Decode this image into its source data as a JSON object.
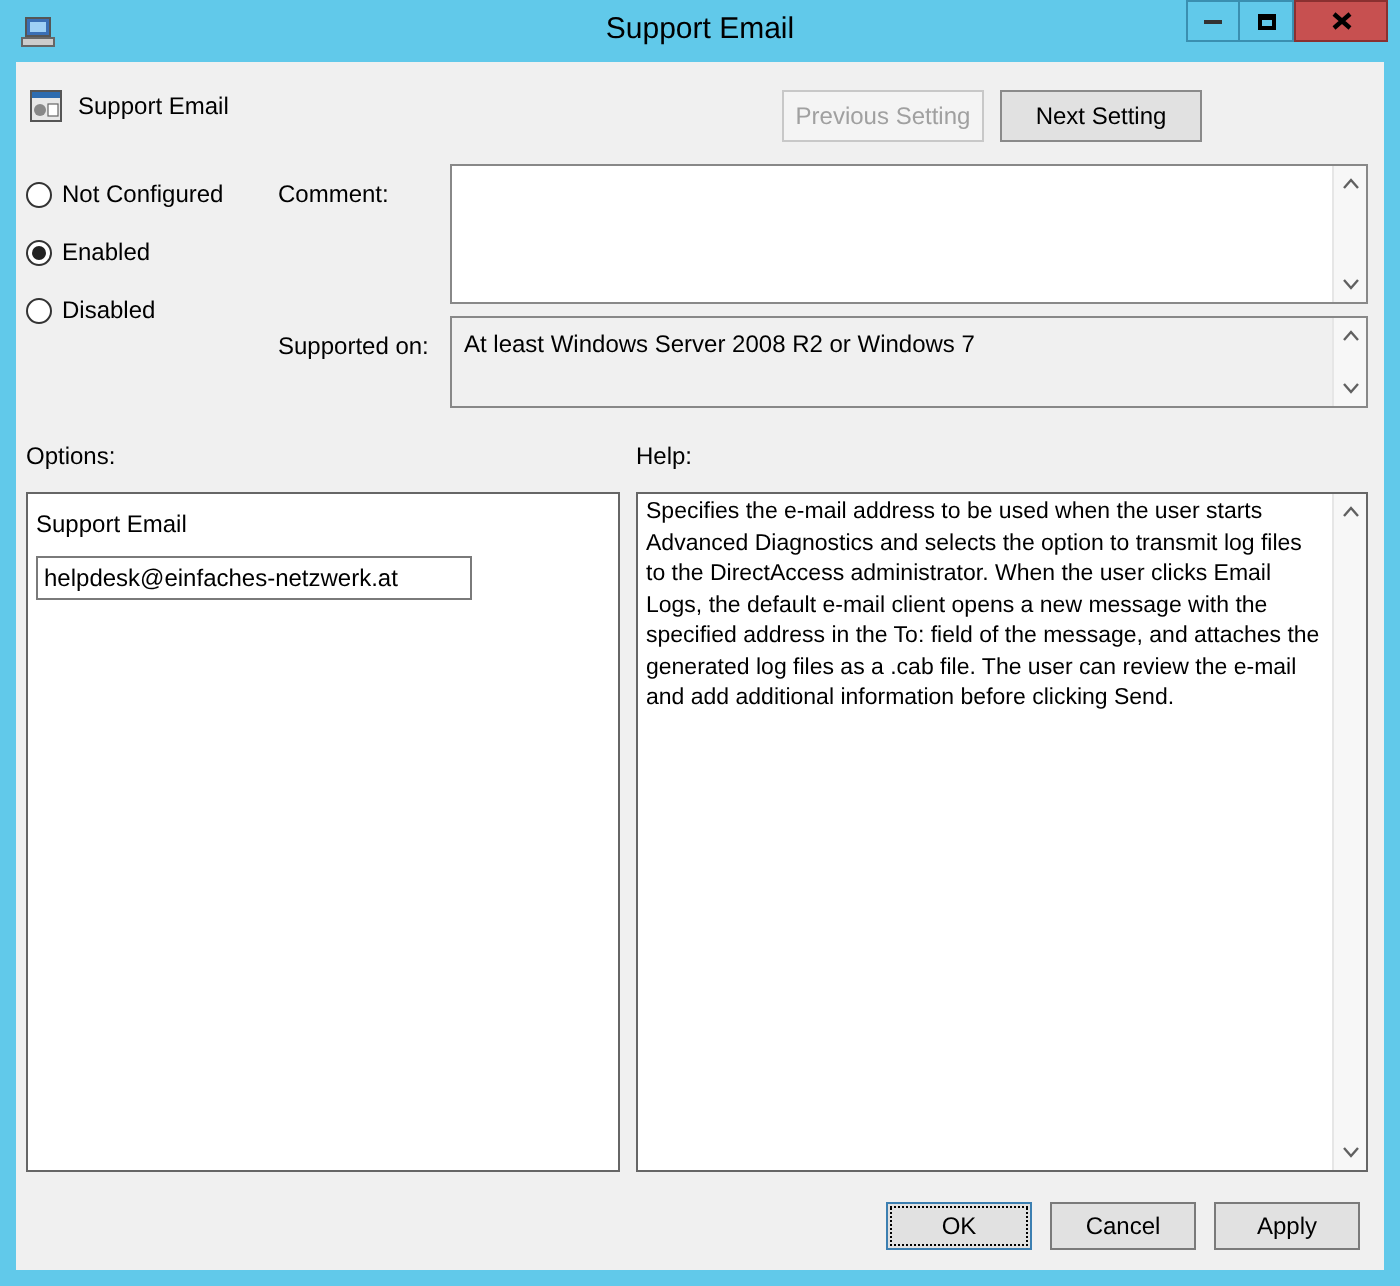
{
  "window": {
    "title": "Support Email"
  },
  "setting": {
    "name": "Support Email"
  },
  "nav_buttons": [
    {
      "label": "Previous Setting",
      "disabled": true
    },
    {
      "label": "Next Setting",
      "disabled": false
    }
  ],
  "radios": [
    {
      "label": "Not Configured",
      "selected": false
    },
    {
      "label": "Enabled",
      "selected": true
    },
    {
      "label": "Disabled",
      "selected": false
    }
  ],
  "comment": {
    "label": "Comment:"
  },
  "supported_on": {
    "label": "Supported on:",
    "value": "At least Windows Server 2008 R2 or Windows 7"
  },
  "options": {
    "label": "Options:",
    "field_label": "Support Email",
    "value": "helpdesk@einfaches-netzwerk.at"
  },
  "help": {
    "label": "Help:",
    "text": "Specifies the e-mail address to be used when the user starts Advanced Diagnostics and selects the option to transmit log files to the DirectAccess administrator. When the user clicks Email Logs, the default e-mail client opens a new message with the specified address in the To: field of the message, and attaches the generated log files as a .cab file. The user can review the e-mail and add additional information before clicking Send."
  },
  "buttons": [
    {
      "label": "OK",
      "focused": true
    },
    {
      "label": "Cancel",
      "focused": false
    },
    {
      "label": "Apply",
      "focused": false
    }
  ]
}
